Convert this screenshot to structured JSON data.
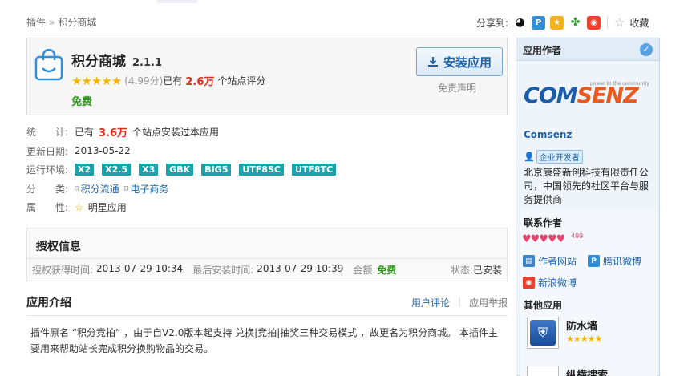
{
  "breadcrumb": {
    "item1": "插件",
    "sep": "»",
    "item2": "积分商城"
  },
  "share": {
    "label": "分享到:",
    "icons": [
      "qq-icon",
      "qzone-icon",
      "tencent-weibo-icon",
      "kaixin-icon",
      "sina-weibo-icon"
    ],
    "fav_label": "收藏"
  },
  "plugin": {
    "name": "积分商城",
    "version": "2.1.1",
    "stars": "★★★★★",
    "score": "(4.99分)",
    "rated_prefix": "已有",
    "rated_count": "2.6万",
    "rated_suffix": "个站点评分",
    "price": "免费",
    "install_label": "安装应用",
    "disclaimer": "免责声明"
  },
  "info": {
    "stat_label": "统　　计:",
    "stat_prefix": "已有",
    "stat_count": "3.6万",
    "stat_suffix": "个站点安装过本应用",
    "update_label": "更新日期:",
    "update_value": "2013-05-22",
    "env_label": "运行环境:",
    "env": [
      "X2",
      "X2.5",
      "X3",
      "GBK",
      "BIG5",
      "UTF8SC",
      "UTF8TC"
    ],
    "cat_label": "分　　类:",
    "categories": [
      "积分流通",
      "电子商务"
    ],
    "attr_label": "属　　性:",
    "attr_value": "明星应用"
  },
  "license": {
    "title": "授权信息",
    "obtain_label": "授权获得时间:",
    "obtain_value": "2013-07-29 10:34",
    "last_label": "最后安装时间:",
    "last_value": "2013-07-29 10:39",
    "amount_label": "金额:",
    "amount_value": "免费",
    "status_label": "状态:",
    "status_value": "已安装"
  },
  "intro": {
    "title": "应用介绍",
    "comments": "用户评论",
    "sep": "|",
    "report": "应用举报",
    "text": "插件原名 “积分竞拍” ，由于自V2.0版本起支持 兑换|竞拍|抽奖三种交易模式 ，故更名为积分商城。 本插件主要用来帮助站长完成积分换购物品的交易。"
  },
  "sidebar": {
    "title": "应用作者",
    "brand_main": "COM",
    "brand_accent": "SENZ",
    "brand_tagline": "power to the community",
    "author": "Comsenz",
    "badge": "企业开发者",
    "desc": "北京康盛新创科技有限责任公司，中国领先的社区平台与服务提供商",
    "contact_title": "联系作者",
    "hearts": "♥♥♥♥♥",
    "heart_count": "499",
    "links": [
      "作者网站",
      "腾讯微博",
      "新浪微博"
    ],
    "other_title": "其他应用",
    "app1_name": "防水墙",
    "app1_stars": "★★★★★",
    "app2_name": "纵横搜索"
  }
}
